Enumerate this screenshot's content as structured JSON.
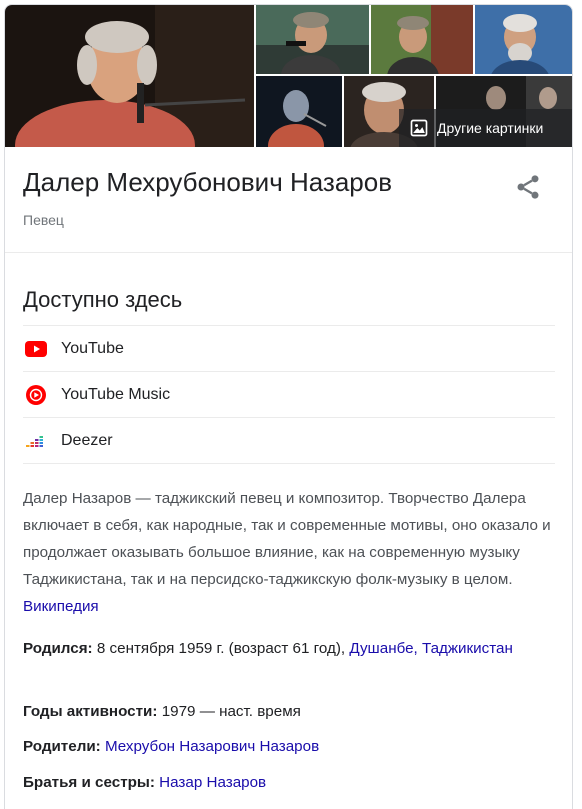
{
  "gallery": {
    "more_images_label": "Другие картинки"
  },
  "header": {
    "title": "Далер Мехрубонович Назаров",
    "subtitle": "Певец"
  },
  "available": {
    "heading": "Доступно здесь",
    "services": [
      {
        "label": "YouTube",
        "icon": "youtube-icon",
        "color": "#ff0000"
      },
      {
        "label": "YouTube Music",
        "icon": "youtube-music-icon",
        "color": "#ff0000"
      },
      {
        "label": "Deezer",
        "icon": "deezer-icon",
        "color": "#f6a41b"
      }
    ]
  },
  "description": {
    "text": "Далер Назаров — таджикский певец и композитор. Творчество Далера включает в себя, как народные, так и современные мотивы, оно оказало и продолжает оказывать большое влияние, как на современную музыку Таджикистана, так и на персидско-таджикскую фолк-музыку в целом.",
    "source_link": "Википедия"
  },
  "facts": {
    "born_label": "Родился:",
    "born_value": "8 сентября 1959 г. (возраст 61 год),",
    "born_place_link": "Душанбе, Таджикистан",
    "active_label": "Годы активности:",
    "active_value": "1979 — наст. время",
    "parents_label": "Родители:",
    "parents_link": "Мехрубон Назарович Назаров",
    "siblings_label": "Братья и сестры:",
    "siblings_link": "Назар Назаров"
  },
  "colors": {
    "link": "#1a0dab",
    "text": "#202124",
    "muted": "#70757a",
    "divider": "#ebebeb"
  }
}
